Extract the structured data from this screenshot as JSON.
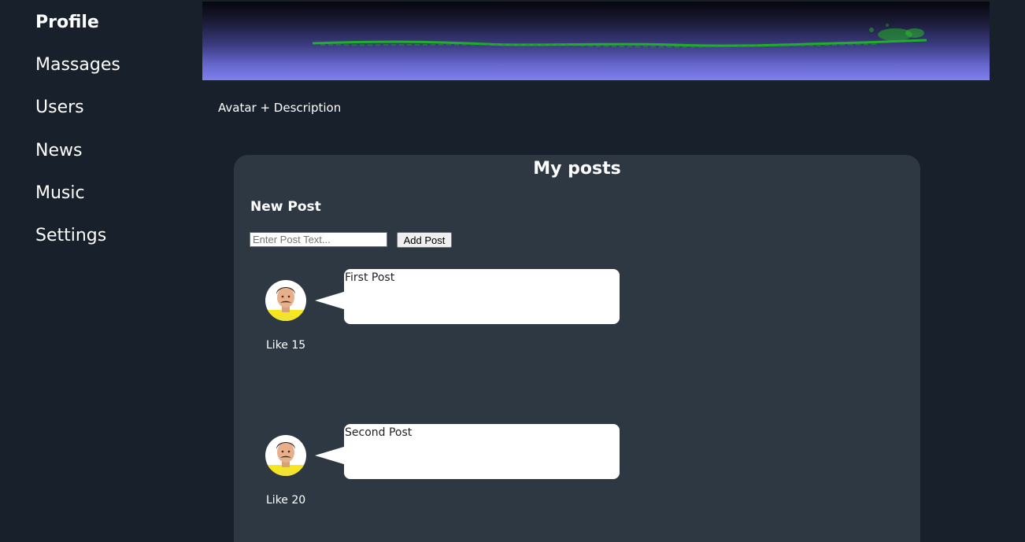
{
  "nav": {
    "items": [
      {
        "label": "Profile",
        "active": true
      },
      {
        "label": "Massages",
        "active": false
      },
      {
        "label": "Users",
        "active": false
      },
      {
        "label": "News",
        "active": false
      },
      {
        "label": "Music",
        "active": false
      },
      {
        "label": "Settings",
        "active": false
      }
    ]
  },
  "profile": {
    "description": "Avatar + Description"
  },
  "posts": {
    "title": "My posts",
    "new_post": {
      "title": "New Post",
      "input_placeholder": "Enter Post Text...",
      "input_value": "",
      "button_label": "Add Post"
    },
    "items": [
      {
        "text": "First Post",
        "likes": "Like 15",
        "avatar_icon": "man-avatar-icon"
      },
      {
        "text": "Second Post",
        "likes": "Like 20",
        "avatar_icon": "man-avatar-icon"
      }
    ]
  },
  "colors": {
    "background": "#17202b",
    "panel": "#2e3843",
    "bubble": "#ffffff",
    "text": "#ffffff"
  }
}
